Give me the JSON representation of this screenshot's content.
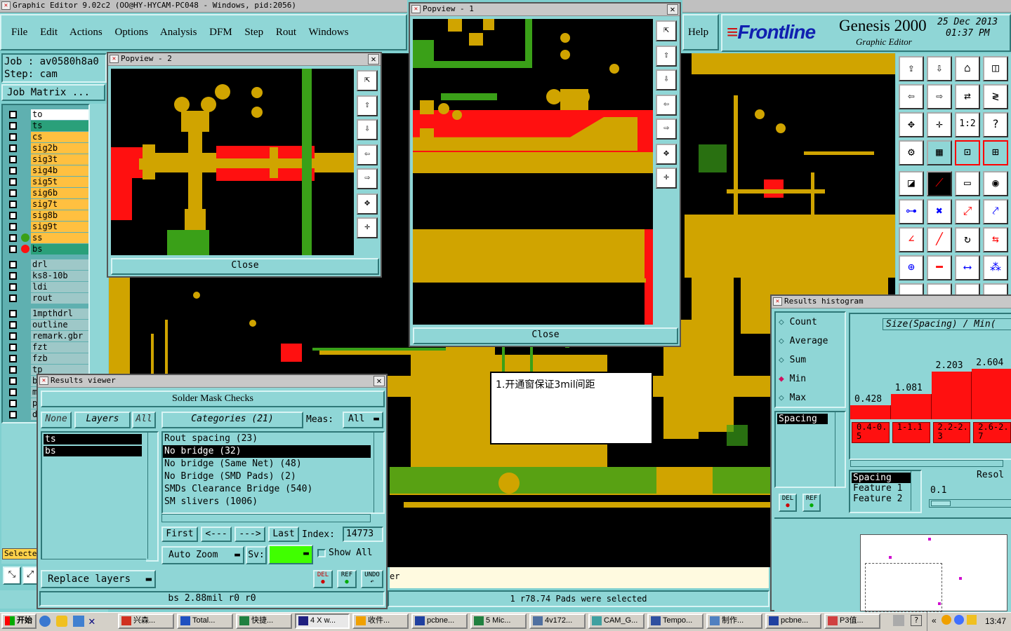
{
  "title": "Graphic Editor 9.02c2 (OO@HY-HYCAM-PC048 - Windows, pid:2056)",
  "menu": [
    "File",
    "Edit",
    "Actions",
    "Options",
    "Analysis",
    "DFM",
    "Step",
    "Rout",
    "Windows"
  ],
  "help": "Help",
  "brand": {
    "logo": "Frontline",
    "product": "Genesis 2000",
    "subtitle": "Graphic Editor",
    "date": "25 Dec 2013",
    "time": "01:37 PM"
  },
  "job": {
    "label": "Job : av0580h8a0",
    "step": "Step: cam",
    "matrix": "Job Matrix ..."
  },
  "layers": [
    "to",
    "ts",
    "cs",
    "sig2b",
    "sig3t",
    "sig4b",
    "sig5t",
    "sig6b",
    "sig7t",
    "sig8b",
    "sig9t",
    "ss",
    "bs"
  ],
  "layers2": [
    "drl",
    "ks8-10b",
    "ldi",
    "rout"
  ],
  "layers3": [
    "1mpthdrl",
    "outline",
    "remark.gbr",
    "fzt",
    "fzb",
    "tp",
    "b",
    "m",
    "p",
    "d"
  ],
  "select_label": "Selecte",
  "popview2": {
    "title": "Popview - 2",
    "close": "Close"
  },
  "popview1": {
    "title": "Popview - 1",
    "close": "Close"
  },
  "note": "1.开通窗保证3mil间距",
  "status_right": "1 r78.74 Pads were selected",
  "status_er": "er",
  "results": {
    "title": "Results viewer",
    "header": "Solder Mask Checks",
    "none": "None",
    "layers": "Layers",
    "all": "All",
    "layer_items": [
      "ts",
      "bs"
    ],
    "categories": "Categories (21)",
    "meas_label": "Meas:",
    "meas_value": "All",
    "items": [
      "Rout spacing (23)",
      "No bridge (32)",
      "No bridge (Same Net) (48)",
      "No Bridge (SMD Pads) (2)",
      "SMDs Clearance Bridge (540)",
      "SM slivers (1006)"
    ],
    "first": "First",
    "prev": "<---",
    "next": "--->",
    "last": "Last",
    "index_label": "Index:",
    "index": "14773",
    "auto_zoom": "Auto Zoom",
    "sv": "Sv:",
    "show_all": "Show All",
    "replace": "Replace layers",
    "del": "DEL",
    "ref": "REF",
    "undo": "UNDO",
    "status": "bs 2.88mil  r0  r0"
  },
  "histogram": {
    "title": "Results histogram",
    "options": [
      "Count",
      "Average",
      "Sum",
      "Min",
      "Max"
    ],
    "selected": "Min",
    "header": "Size(Spacing) / Min(",
    "list": [
      "Spacing"
    ],
    "bars": [
      {
        "value": "0.428",
        "range": "0.4-0.5",
        "level": 0.25
      },
      {
        "value": "1.081",
        "range": "1-1.1",
        "level": 0.45
      },
      {
        "value": "2.203",
        "range": "2.2-2.3",
        "level": 0.85
      },
      {
        "value": "2.604",
        "range": "2.6-2.7",
        "level": 0.9
      }
    ],
    "opts": [
      "Spacing",
      "Feature 1",
      "Feature 2"
    ],
    "resol_label": "Resol",
    "resol_value": "0.1",
    "del": "DEL",
    "ref": "REF"
  },
  "taskbar": {
    "start": "开始",
    "items": [
      "兴森...",
      "Total...",
      "快捷...",
      "4 X w...",
      "收件...",
      "pcbne...",
      "5 Mic...",
      "4v172...",
      "CAM_G...",
      "Tempo...",
      "制作...",
      "pcbne...",
      "P3值..."
    ],
    "clock": "13:47"
  },
  "colors": {
    "bg": "#7fcfcf",
    "pad": "#d0a400",
    "trace": "#3aa018",
    "highlight": "#ff1010"
  }
}
